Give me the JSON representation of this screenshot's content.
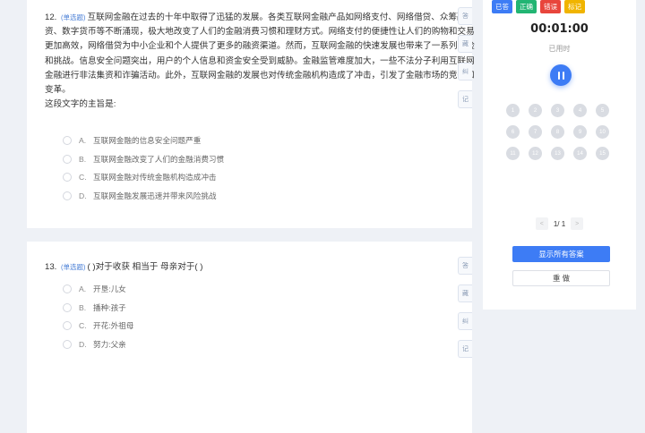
{
  "colors": {
    "accent": "#3d7cf5",
    "answered": "#3d7cf5",
    "correct": "#22b573",
    "wrong": "#e8453c",
    "marked": "#f0b400"
  },
  "q12": {
    "number": "12.",
    "type": "(单选题)",
    "stem": "互联网金融在过去的十年中取得了迅猛的发展。各类互联网金融产品如网络支付、网络借贷、众筹融资、数字货币等不断涌现，极大地改变了人们的金融消费习惯和理财方式。网络支付的便捷性让人们的购物和交易更加高效，网络借贷为中小企业和个人提供了更多的融资渠道。然而，互联网金融的快速发展也带来了一系列风险和挑战。信息安全问题突出，用户的个人信息和资金安全受到威胁。金融监管难度加大，一些不法分子利用互联网金融进行非法集资和诈骗活动。此外，互联网金融的发展也对传统金融机构造成了冲击，引发了金融市场的竞争和变革。",
    "prompt": "这段文字的主旨是:",
    "options": [
      {
        "letter": "A.",
        "text": "互联网金融的信息安全问题严重"
      },
      {
        "letter": "B.",
        "text": "互联网金融改变了人们的金融消费习惯"
      },
      {
        "letter": "C.",
        "text": "互联网金融对传统金融机构造成冲击"
      },
      {
        "letter": "D.",
        "text": "互联网金融发展迅速并带来风险挑战"
      }
    ],
    "tools": [
      "答",
      "藏",
      "纠",
      "记"
    ]
  },
  "q13": {
    "number": "13.",
    "type": "(单选题)",
    "stem": "(   )对于收获 相当于 母亲对于(   )",
    "options": [
      {
        "letter": "A.",
        "text": "开垦:儿女"
      },
      {
        "letter": "B.",
        "text": "播种:孩子"
      },
      {
        "letter": "C.",
        "text": "开花:外祖母"
      },
      {
        "letter": "D.",
        "text": "努力:父亲"
      }
    ],
    "tools": [
      "答",
      "藏",
      "纠",
      "记"
    ]
  },
  "panel": {
    "legend": [
      {
        "label": "已答",
        "color": "#3d7cf5"
      },
      {
        "label": "正确",
        "color": "#22b573"
      },
      {
        "label": "错误",
        "color": "#e8453c"
      },
      {
        "label": "标记",
        "color": "#f0b400"
      }
    ],
    "timer": "00:01:00",
    "elapsed_label": "已用时",
    "pause_icon": "pause-icon",
    "question_numbers": [
      "1",
      "2",
      "3",
      "4",
      "5",
      "6",
      "7",
      "8",
      "9",
      "10",
      "11",
      "12",
      "13",
      "14",
      "15"
    ],
    "pager": {
      "prev": "<",
      "page": "1/ 1",
      "next": ">"
    },
    "show_answers_label": "显示所有答案",
    "redo_label": "重 做"
  }
}
